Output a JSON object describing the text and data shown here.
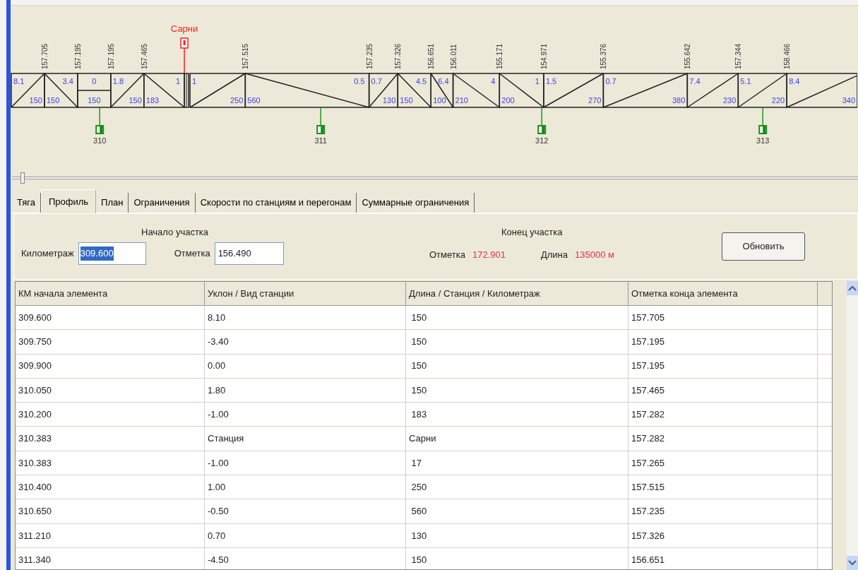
{
  "profile": {
    "segments": [
      {
        "kind": "rise",
        "grade": "8.1",
        "length": "150",
        "end_mark": "157.705"
      },
      {
        "kind": "fall",
        "grade": "3.4",
        "length": "150",
        "end_mark": "157.195"
      },
      {
        "kind": "level",
        "grade": "0",
        "length": "150",
        "end_mark": "157.195"
      },
      {
        "kind": "rise",
        "grade": "1.8",
        "length": "150",
        "end_mark": "157.465"
      },
      {
        "kind": "fall",
        "grade": "1",
        "length": "183"
      },
      {
        "kind": "station",
        "name": "Сарни"
      },
      {
        "kind": "rise",
        "grade": "1",
        "length": "250",
        "end_mark": "157.515"
      },
      {
        "kind": "fall",
        "grade": "0.5",
        "length": "560",
        "end_mark": "157.235"
      },
      {
        "kind": "rise",
        "grade": "0.7",
        "length": "130",
        "end_mark": "157.326"
      },
      {
        "kind": "fall",
        "grade": "4.5",
        "length": "150",
        "end_mark": "156.651"
      },
      {
        "kind": "fall",
        "grade": "6.4",
        "length": "100",
        "end_mark": "156.011"
      },
      {
        "kind": "fall",
        "grade": "4",
        "length": "210",
        "end_mark": "155.171"
      },
      {
        "kind": "fall",
        "grade": "1",
        "length": "200",
        "end_mark": "154.971"
      },
      {
        "kind": "rise",
        "grade": "1.5",
        "length": "270",
        "end_mark": "155.376"
      },
      {
        "kind": "rise",
        "grade": "0.7",
        "length": "380",
        "end_mark": "155.642"
      },
      {
        "kind": "rise",
        "grade": "7.4",
        "length": "230",
        "end_mark": "157.344"
      },
      {
        "kind": "rise",
        "grade": "5.1",
        "length": "220",
        "end_mark": "158.466"
      },
      {
        "kind": "rise",
        "grade": "8.4",
        "length": "340"
      }
    ],
    "km_posts": [
      "310",
      "311",
      "312",
      "313"
    ]
  },
  "tabs": [
    {
      "label": "Тяга",
      "selected": false
    },
    {
      "label": "Профиль",
      "selected": true
    },
    {
      "label": "План",
      "selected": false
    },
    {
      "label": "Ограничения",
      "selected": false
    },
    {
      "label": "Скорости по станциям и перегонам",
      "selected": false
    },
    {
      "label": "Суммарные ограничения",
      "selected": false
    }
  ],
  "section_start": {
    "title": "Начало участка",
    "km_label": "Километраж",
    "km_value": "309.600",
    "km_value_highlighted": true,
    "mark_label": "Отметка",
    "mark_value": "156.490"
  },
  "section_end": {
    "title": "Конец участка",
    "mark_label": "Отметка",
    "mark_value": "172.901",
    "length_label": "Длина",
    "length_value": "135000 м"
  },
  "refresh_button": "Обновить",
  "table": {
    "columns": [
      "КМ начала элемента",
      "Уклон / Вид станции",
      "Длина / Станция / Километраж",
      "Отметка конца элемента"
    ],
    "rows": [
      [
        "309.600",
        "8.10",
        " 150",
        "157.705"
      ],
      [
        "309.750",
        "-3.40",
        " 150",
        "157.195"
      ],
      [
        "309.900",
        "0.00",
        " 150",
        "157.195"
      ],
      [
        "310.050",
        "1.80",
        " 150",
        "157.465"
      ],
      [
        "310.200",
        "-1.00",
        " 183",
        "157.282"
      ],
      [
        "310.383",
        "Станция",
        "Сарни",
        "157.282"
      ],
      [
        "310.383",
        "-1.00",
        " 17",
        "157.265"
      ],
      [
        "310.400",
        "1.00",
        " 250",
        "157.515"
      ],
      [
        "310.650",
        "-0.50",
        " 560",
        "157.235"
      ],
      [
        "311.210",
        "0.70",
        " 130",
        "157.326"
      ],
      [
        "311.340",
        "-4.50",
        " 150",
        "156.651"
      ]
    ]
  }
}
